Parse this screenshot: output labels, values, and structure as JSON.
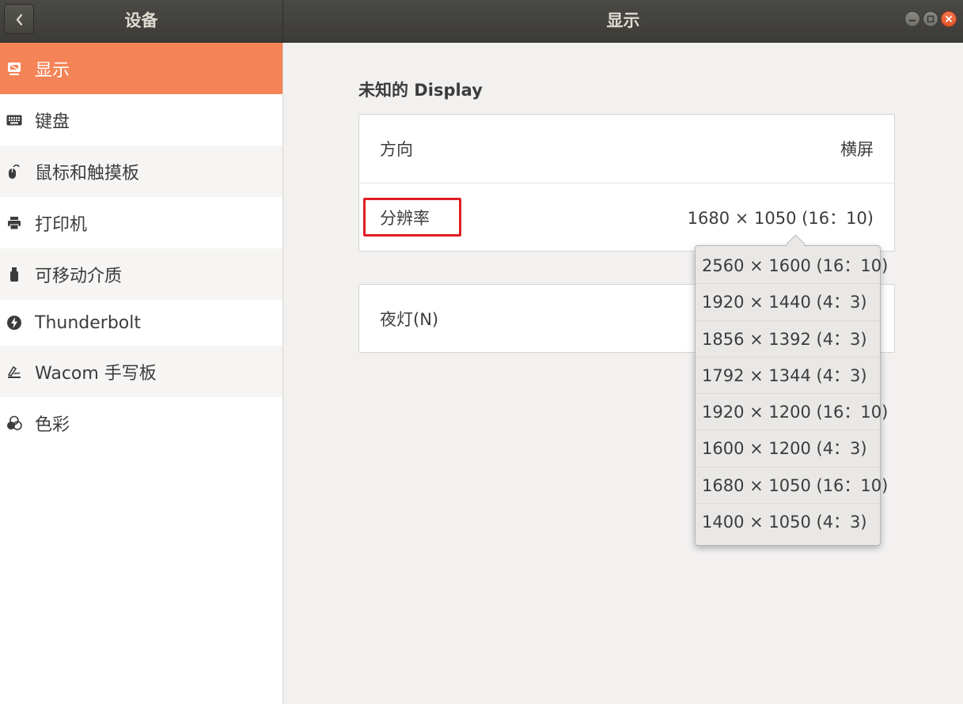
{
  "header": {
    "left_title": "设备",
    "title": "显示"
  },
  "sidebar": {
    "items": [
      {
        "label": "显示",
        "icon": "display-icon",
        "selected": true
      },
      {
        "label": "键盘",
        "icon": "keyboard-icon"
      },
      {
        "label": "鼠标和触摸板",
        "icon": "mouse-icon"
      },
      {
        "label": "打印机",
        "icon": "printer-icon"
      },
      {
        "label": "可移动介质",
        "icon": "usb-drive-icon"
      },
      {
        "label": "Thunderbolt",
        "icon": "thunderbolt-icon"
      },
      {
        "label": "Wacom 手写板",
        "icon": "tablet-icon"
      },
      {
        "label": "色彩",
        "icon": "color-icon"
      }
    ]
  },
  "main": {
    "section_title": "未知的 Display",
    "orientation": {
      "label": "方向",
      "value": "横屏"
    },
    "resolution": {
      "label": "分辨率",
      "value": "1680 × 1050 (16：10)"
    },
    "night_light": {
      "label": "夜灯(N)"
    }
  },
  "resolution_menu": {
    "options": [
      "2560 × 1600 (16：10)",
      "1920 × 1440 (4：3)",
      "1856 × 1392 (4：3)",
      "1792 × 1344 (4：3)",
      "1920 × 1200 (16：10)",
      "1600 × 1200 (4：3)",
      "1680 × 1050 (16：10)",
      "1400 × 1050 (4：3)"
    ]
  },
  "colors": {
    "accent": "#f48457",
    "highlight_box": "#e11d24",
    "headerbar": "#3c3b37"
  }
}
